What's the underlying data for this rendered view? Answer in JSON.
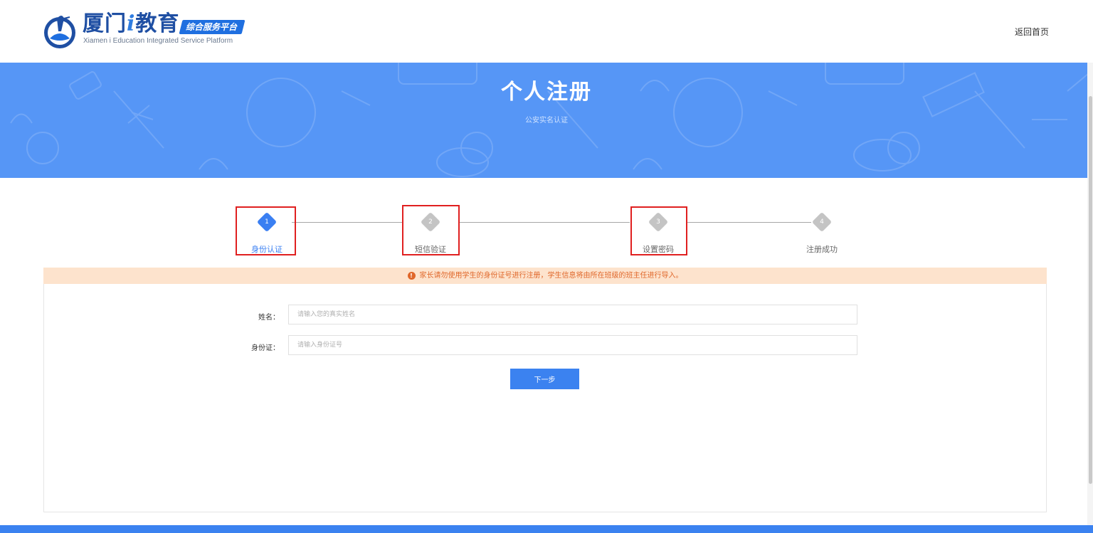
{
  "header": {
    "logo_cn_part1": "厦门",
    "logo_cn_i": "i",
    "logo_cn_part2": "教育",
    "logo_badge": "综合服务平台",
    "logo_en": "Xiamen i Education Integrated Service Platform",
    "home_link": "返回首页"
  },
  "banner": {
    "title": "个人注册",
    "subtitle": "公安实名认证"
  },
  "steps": [
    {
      "num": "1",
      "label": "身份认证",
      "active": true
    },
    {
      "num": "2",
      "label": "短信验证",
      "active": false
    },
    {
      "num": "3",
      "label": "设置密码",
      "active": false
    },
    {
      "num": "4",
      "label": "注册成功",
      "active": false
    }
  ],
  "notice": {
    "icon": "!",
    "text": "家长请勿使用学生的身份证号进行注册，学生信息将由所在班级的班主任进行导入。"
  },
  "form": {
    "name_label": "姓名：",
    "name_placeholder": "请输入您的真实姓名",
    "id_label": "身份证：",
    "id_placeholder": "请输入身份证号",
    "next_button": "下一步"
  },
  "colors": {
    "primary": "#3b82f0",
    "banner": "#5696f6",
    "notice_bg": "#fde3cd",
    "notice_text": "#e0672a",
    "highlight": "#e02020"
  }
}
